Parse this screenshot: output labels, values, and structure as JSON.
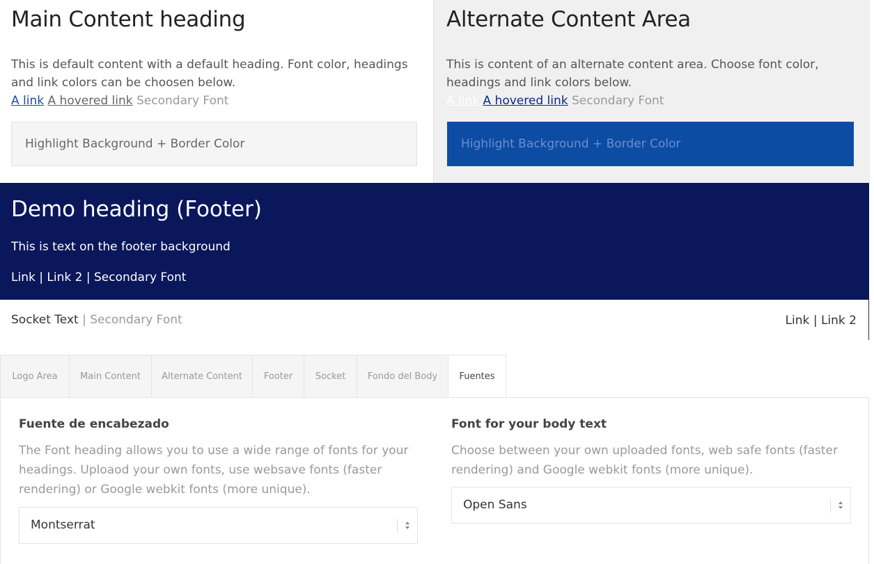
{
  "main_content": {
    "heading": "Main Content heading",
    "paragraph": "This is default content with a default heading. Font color, headings and link colors can be choosen below.",
    "link": "A link",
    "hovered_link": "A hovered link",
    "secondary_font": "Secondary Font",
    "highlight": "Highlight Background + Border Color"
  },
  "alternate_content": {
    "heading": "Alternate Content Area",
    "paragraph": "This is content of an alternate content area. Choose font color, headings and link colors below.",
    "link": "A link",
    "hovered_link": "A hovered link",
    "secondary_font": "Secondary Font",
    "highlight": "Highlight Background + Border Color"
  },
  "footer": {
    "heading": "Demo heading (Footer)",
    "text": "This is text on the footer background",
    "link1": "Link",
    "separator": "|",
    "link2": "Link 2",
    "secondary_font": "Secondary Font"
  },
  "socket": {
    "text": "Socket Text",
    "separator": "|",
    "secondary_font": "Secondary Font",
    "link1": "Link",
    "link2": "Link 2"
  },
  "tabs": [
    {
      "label": "Logo Area",
      "active": false
    },
    {
      "label": "Main Content",
      "active": false
    },
    {
      "label": "Alternate Content",
      "active": false
    },
    {
      "label": "Footer",
      "active": false
    },
    {
      "label": "Socket",
      "active": false
    },
    {
      "label": "Fondo del Body",
      "active": false
    },
    {
      "label": "Fuentes",
      "active": true
    }
  ],
  "fonts_panel": {
    "heading_font": {
      "title": "Fuente de encabezado",
      "description": "The Font heading allows you to use a wide range of fonts for your headings. Uploaod your own fonts, use websave fonts (faster rendering) or Google webkit fonts (more unique).",
      "selected": "Montserrat"
    },
    "body_font": {
      "title": "Font for your body text",
      "description": "Choose between your own uploaded fonts, web safe fonts (faster rendering) and Google webkit fonts (more unique).",
      "selected": "Open Sans"
    }
  },
  "colors": {
    "footer_bg": "#0a175b",
    "alt_highlight_bg": "#0d4ca3",
    "alt_bg": "#f0f0f0",
    "main_link": "#1a4aa8"
  }
}
